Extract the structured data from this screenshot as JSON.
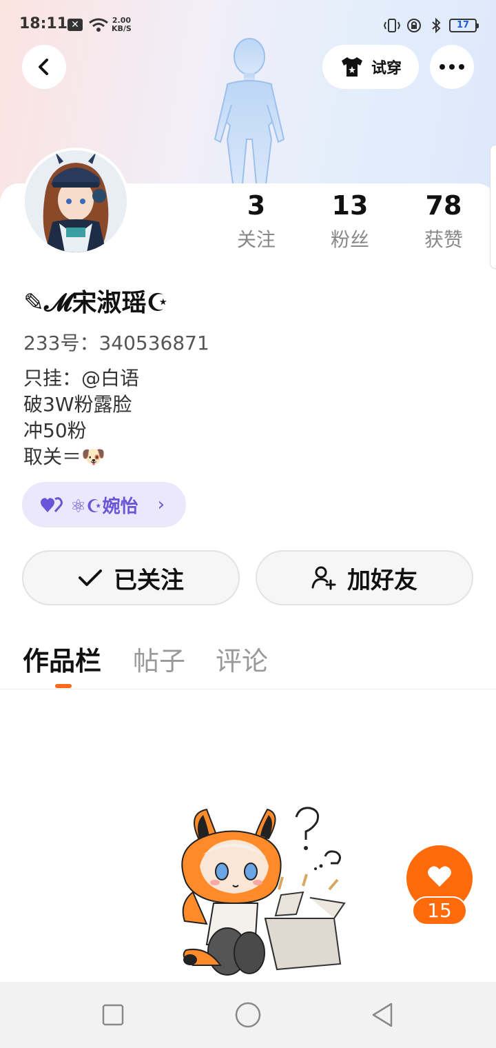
{
  "status_bar": {
    "time": "18:11",
    "net_speed_value": "2.00",
    "net_speed_unit": "KB/S",
    "battery": "17"
  },
  "header": {
    "try_on_label": "试穿"
  },
  "stats": [
    {
      "value": "3",
      "label": "关注"
    },
    {
      "value": "13",
      "label": "粉丝"
    },
    {
      "value": "78",
      "label": "获赞"
    }
  ],
  "profile": {
    "nickname": "✎𝓜宋淑瑶☪",
    "uid": "233号：340536871",
    "bio": [
      "只挂：@白语",
      "破3W粉露脸",
      "冲50粉",
      "取关＝🐶"
    ]
  },
  "cp_badge": {
    "text": "⚛☪婉怡",
    "chevron": "›"
  },
  "actions": {
    "follow_label": "已关注",
    "add_friend_label": "加好友"
  },
  "tabs": [
    "作品栏",
    "帖子",
    "评论"
  ],
  "like_float": {
    "count": "15"
  },
  "colors": {
    "accent": "#ff6a0a",
    "cp_purple": "#6a55d8",
    "cp_bg": "#ebe8fb"
  },
  "icons": [
    "back-icon",
    "tshirt-icon",
    "more-icon",
    "check-icon",
    "add-user-icon",
    "heart-icon",
    "square-icon",
    "circle-icon",
    "triangle-back-icon"
  ]
}
